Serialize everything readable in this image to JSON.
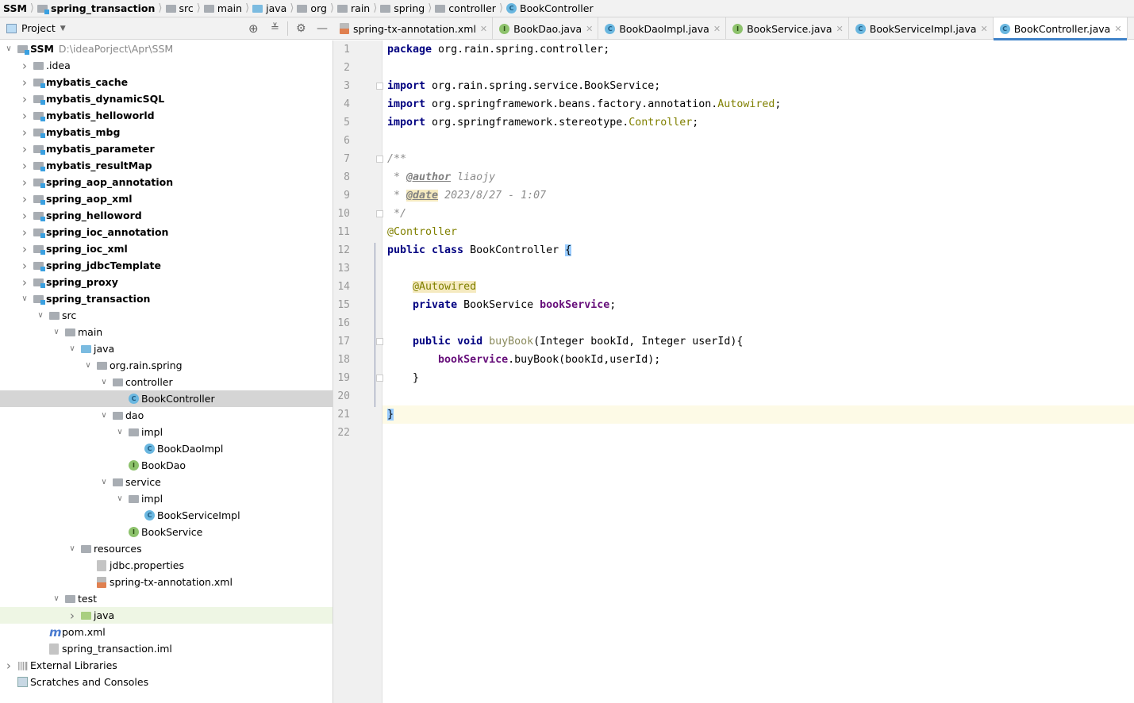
{
  "breadcrumb": [
    {
      "label": "SSM",
      "icon": "none",
      "bold": true
    },
    {
      "label": "spring_transaction",
      "icon": "module-folder",
      "bold": true
    },
    {
      "label": "src",
      "icon": "folder"
    },
    {
      "label": "main",
      "icon": "folder"
    },
    {
      "label": "java",
      "icon": "source-folder"
    },
    {
      "label": "org",
      "icon": "package"
    },
    {
      "label": "rain",
      "icon": "package"
    },
    {
      "label": "spring",
      "icon": "package"
    },
    {
      "label": "controller",
      "icon": "package"
    },
    {
      "label": "BookController",
      "icon": "class"
    }
  ],
  "project_tool": {
    "title": "Project"
  },
  "tabs": [
    {
      "label": "spring-tx-annotation.xml",
      "icon": "xml",
      "active": false
    },
    {
      "label": "BookDao.java",
      "icon": "interface",
      "active": false
    },
    {
      "label": "BookDaoImpl.java",
      "icon": "class",
      "active": false
    },
    {
      "label": "BookService.java",
      "icon": "interface",
      "active": false
    },
    {
      "label": "BookServiceImpl.java",
      "icon": "class",
      "active": false
    },
    {
      "label": "BookController.java",
      "icon": "class",
      "active": true
    }
  ],
  "tree": [
    {
      "label": "SSM",
      "secondary": "D:\\ideaPorject\\Apr\\SSM",
      "depth": 0,
      "state": "open",
      "icon": "module",
      "bold": true
    },
    {
      "label": ".idea",
      "depth": 1,
      "state": "closed",
      "icon": "folder"
    },
    {
      "label": "mybatis_cache",
      "depth": 1,
      "state": "closed",
      "icon": "module",
      "bold": true
    },
    {
      "label": "mybatis_dynamicSQL",
      "depth": 1,
      "state": "closed",
      "icon": "module",
      "bold": true
    },
    {
      "label": "mybatis_helloworld",
      "depth": 1,
      "state": "closed",
      "icon": "module",
      "bold": true
    },
    {
      "label": "mybatis_mbg",
      "depth": 1,
      "state": "closed",
      "icon": "module",
      "bold": true
    },
    {
      "label": "mybatis_parameter",
      "depth": 1,
      "state": "closed",
      "icon": "module",
      "bold": true
    },
    {
      "label": "mybatis_resultMap",
      "depth": 1,
      "state": "closed",
      "icon": "module",
      "bold": true
    },
    {
      "label": "spring_aop_annotation",
      "depth": 1,
      "state": "closed",
      "icon": "module",
      "bold": true
    },
    {
      "label": "spring_aop_xml",
      "depth": 1,
      "state": "closed",
      "icon": "module",
      "bold": true
    },
    {
      "label": "spring_helloword",
      "depth": 1,
      "state": "closed",
      "icon": "module",
      "bold": true
    },
    {
      "label": "spring_ioc_annotation",
      "depth": 1,
      "state": "closed",
      "icon": "module",
      "bold": true
    },
    {
      "label": "spring_ioc_xml",
      "depth": 1,
      "state": "closed",
      "icon": "module",
      "bold": true
    },
    {
      "label": "spring_jdbcTemplate",
      "depth": 1,
      "state": "closed",
      "icon": "module",
      "bold": true
    },
    {
      "label": "spring_proxy",
      "depth": 1,
      "state": "closed",
      "icon": "module",
      "bold": true
    },
    {
      "label": "spring_transaction",
      "depth": 1,
      "state": "open",
      "icon": "module",
      "bold": true
    },
    {
      "label": "src",
      "depth": 2,
      "state": "open",
      "icon": "folder"
    },
    {
      "label": "main",
      "depth": 3,
      "state": "open",
      "icon": "folder"
    },
    {
      "label": "java",
      "depth": 4,
      "state": "open",
      "icon": "source-folder"
    },
    {
      "label": "org.rain.spring",
      "depth": 5,
      "state": "open",
      "icon": "package"
    },
    {
      "label": "controller",
      "depth": 6,
      "state": "open",
      "icon": "package"
    },
    {
      "label": "BookController",
      "depth": 7,
      "state": "none",
      "icon": "class",
      "selected": true
    },
    {
      "label": "dao",
      "depth": 6,
      "state": "open",
      "icon": "package"
    },
    {
      "label": "impl",
      "depth": 7,
      "state": "open",
      "icon": "package"
    },
    {
      "label": "BookDaoImpl",
      "depth": 8,
      "state": "none",
      "icon": "class"
    },
    {
      "label": "BookDao",
      "depth": 7,
      "state": "none",
      "icon": "interface"
    },
    {
      "label": "service",
      "depth": 6,
      "state": "open",
      "icon": "package"
    },
    {
      "label": "impl",
      "depth": 7,
      "state": "open",
      "icon": "package"
    },
    {
      "label": "BookServiceImpl",
      "depth": 8,
      "state": "none",
      "icon": "class"
    },
    {
      "label": "BookService",
      "depth": 7,
      "state": "none",
      "icon": "interface"
    },
    {
      "label": "resources",
      "depth": 4,
      "state": "open",
      "icon": "resources-folder"
    },
    {
      "label": "jdbc.properties",
      "depth": 5,
      "state": "none",
      "icon": "properties"
    },
    {
      "label": "spring-tx-annotation.xml",
      "depth": 5,
      "state": "none",
      "icon": "xml"
    },
    {
      "label": "test",
      "depth": 3,
      "state": "open",
      "icon": "folder"
    },
    {
      "label": "java",
      "depth": 4,
      "state": "closed",
      "icon": "test-folder",
      "highlight": true
    },
    {
      "label": "pom.xml",
      "depth": 2,
      "state": "none",
      "icon": "maven"
    },
    {
      "label": "spring_transaction.iml",
      "depth": 2,
      "state": "none",
      "icon": "iml"
    },
    {
      "label": "External Libraries",
      "depth": 0,
      "state": "closed",
      "icon": "libraries"
    },
    {
      "label": "Scratches and Consoles",
      "depth": 0,
      "state": "none",
      "icon": "scratches"
    }
  ],
  "editor": {
    "current_line": 21,
    "lines": [
      [
        [
          "package",
          "kw"
        ],
        [
          " org.rain.spring.controller;",
          ""
        ]
      ],
      [],
      [
        [
          "import",
          "kw"
        ],
        [
          " org.rain.spring.service.BookService;",
          ""
        ]
      ],
      [
        [
          "import",
          "kw"
        ],
        [
          " org.springframework.beans.factory.annotation.",
          ""
        ],
        [
          "Autowired",
          "an"
        ],
        [
          ";",
          ""
        ]
      ],
      [
        [
          "import",
          "kw"
        ],
        [
          " org.springframework.stereotype.",
          ""
        ],
        [
          "Controller",
          "an"
        ],
        [
          ";",
          ""
        ]
      ],
      [],
      [
        [
          "/**",
          "cm"
        ]
      ],
      [
        [
          " * ",
          "cm"
        ],
        [
          "@author",
          "tg"
        ],
        [
          " liaojy",
          "cm"
        ]
      ],
      [
        [
          " * ",
          "cm"
        ],
        [
          "@date",
          "tg tgh"
        ],
        [
          " 2023/8/27 - 1:07",
          "cm"
        ]
      ],
      [
        [
          " */",
          "cm"
        ]
      ],
      [
        [
          "@Controller",
          "an"
        ]
      ],
      [
        [
          "public class",
          "kw"
        ],
        [
          " BookController ",
          ""
        ],
        [
          "{",
          "br"
        ]
      ],
      [],
      [
        [
          "    ",
          ""
        ],
        [
          "@Autowired",
          "an anh"
        ]
      ],
      [
        [
          "    ",
          ""
        ],
        [
          "private",
          "kw"
        ],
        [
          " BookService ",
          ""
        ],
        [
          "bookService",
          "fd"
        ],
        [
          ";",
          ""
        ]
      ],
      [],
      [
        [
          "    ",
          ""
        ],
        [
          "public void",
          "kw"
        ],
        [
          " ",
          ""
        ],
        [
          "buyBook",
          "md"
        ],
        [
          "(Integer bookId, Integer userId){",
          ""
        ]
      ],
      [
        [
          "        ",
          ""
        ],
        [
          "bookService",
          "fd"
        ],
        [
          ".buyBook(bookId,userId);",
          ""
        ]
      ],
      [
        [
          "    }",
          ""
        ]
      ],
      [],
      [
        [
          "}",
          "br"
        ]
      ],
      []
    ]
  }
}
